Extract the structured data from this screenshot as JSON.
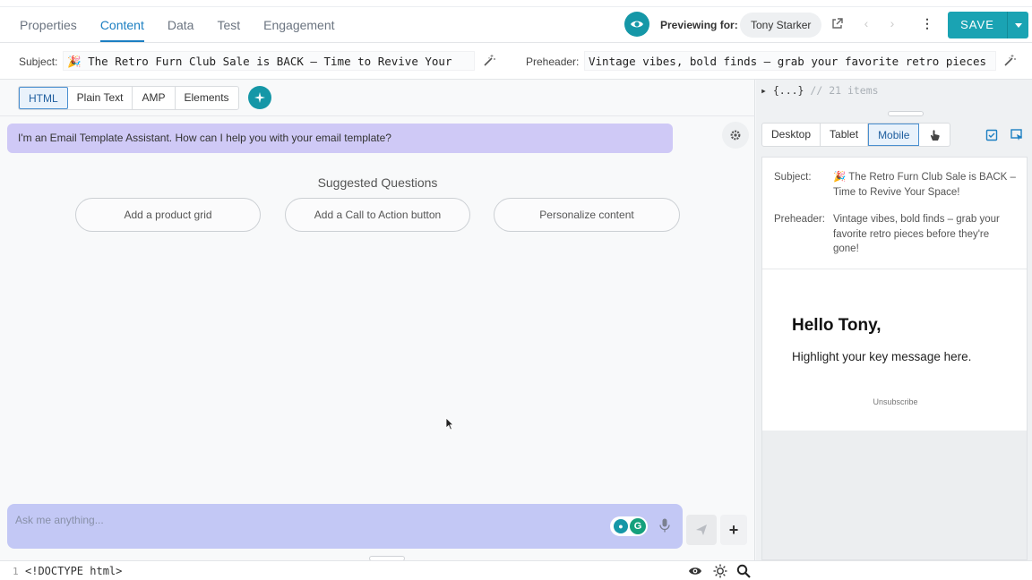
{
  "top_tabs": [
    {
      "label": "Properties"
    },
    {
      "label": "Content"
    },
    {
      "label": "Data"
    },
    {
      "label": "Test"
    },
    {
      "label": "Engagement"
    }
  ],
  "header": {
    "previewing_label": "Previewing for:",
    "previewing_user": "Tony Starker",
    "save_label": "SAVE"
  },
  "subject": {
    "label": "Subject:",
    "value": "🎉 The Retro Furn Club Sale is BACK – Time to Revive Your"
  },
  "preheader": {
    "label": "Preheader:",
    "value": "Vintage vibes, bold finds – grab your favorite retro pieces"
  },
  "editor_modes": [
    {
      "label": "HTML"
    },
    {
      "label": "Plain Text"
    },
    {
      "label": "AMP"
    },
    {
      "label": "Elements"
    }
  ],
  "assistant": {
    "greeting": "I'm an Email Template Assistant. How can I help you with your email template?",
    "suggested_title": "Suggested Questions",
    "suggestions": [
      {
        "label": "Add a product grid"
      },
      {
        "label": "Add a Call to Action button"
      },
      {
        "label": "Personalize content"
      }
    ],
    "input_placeholder": "Ask me anything..."
  },
  "code": {
    "line_number": "1",
    "line_text": "<!DOCTYPE html>"
  },
  "json_viewer": {
    "collapsed": "{...}",
    "comment": "// 21 items"
  },
  "device_tabs": [
    {
      "label": "Desktop"
    },
    {
      "label": "Tablet"
    },
    {
      "label": "Mobile"
    }
  ],
  "preview": {
    "subject_label": "Subject:",
    "subject_value": "🎉 The Retro Furn Club Sale is BACK – Time to Revive Your Space!",
    "preheader_label": "Preheader:",
    "preheader_value": "Vintage vibes, bold finds – grab your favorite retro pieces before they're gone!",
    "greeting": "Hello Tony,",
    "message": "Highlight your key message here.",
    "unsubscribe": "Unsubscribe"
  },
  "colors": {
    "accent": "#1597a7",
    "active_tab": "#1c7fc2",
    "assistant_bubble": "#cfc9f6",
    "chat_input": "#c3c8f5"
  }
}
